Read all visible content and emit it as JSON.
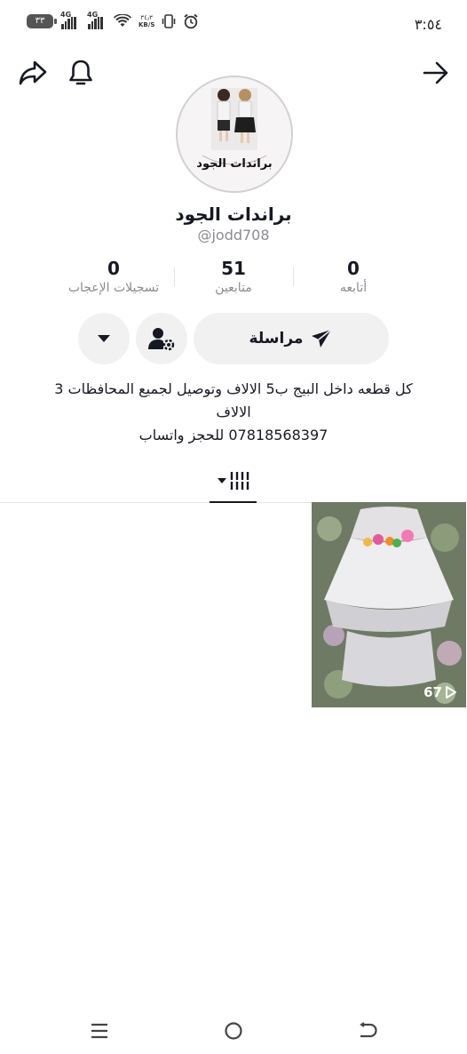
{
  "status_bar": {
    "time": "٣:٥٤",
    "battery": "٣٣",
    "signal1_label": "4G",
    "signal2_label": "4G",
    "net_speed_value": "٣٤٫٣",
    "net_speed_unit": "KB/S",
    "icons": [
      "battery-icon",
      "signal-icon",
      "wifi-icon",
      "vibrate-icon",
      "alarm-icon"
    ]
  },
  "nav": {
    "icons": [
      "share-icon",
      "bell-icon",
      "back-arrow-icon"
    ]
  },
  "profile": {
    "avatar_brand_text": "براندات الجود",
    "display_name": "براندات الجود",
    "handle": "@jodd708"
  },
  "stats": [
    {
      "value": "0",
      "label": "أتابعه"
    },
    {
      "value": "51",
      "label": "متابعين"
    },
    {
      "value": "0",
      "label": "تسجيلات الإعجاب"
    }
  ],
  "actions": {
    "message_label": "مراسلة",
    "icons": [
      "send-icon",
      "user-settings-icon",
      "caret-down-icon"
    ]
  },
  "bio": {
    "line1": "كل قطعه داخل البيج ب5 الالاف وتوصيل لجميع المحافظات 3",
    "line2": "الالاف",
    "line3": "07818568397 للحجز واتساب"
  },
  "tabs": {
    "icons": [
      "videos-grid-icon",
      "dropdown-caret-icon"
    ]
  },
  "videos": [
    {
      "views": "67"
    }
  ],
  "system_nav": {
    "icons": [
      "menu-icon",
      "home-icon",
      "back-icon"
    ]
  }
}
